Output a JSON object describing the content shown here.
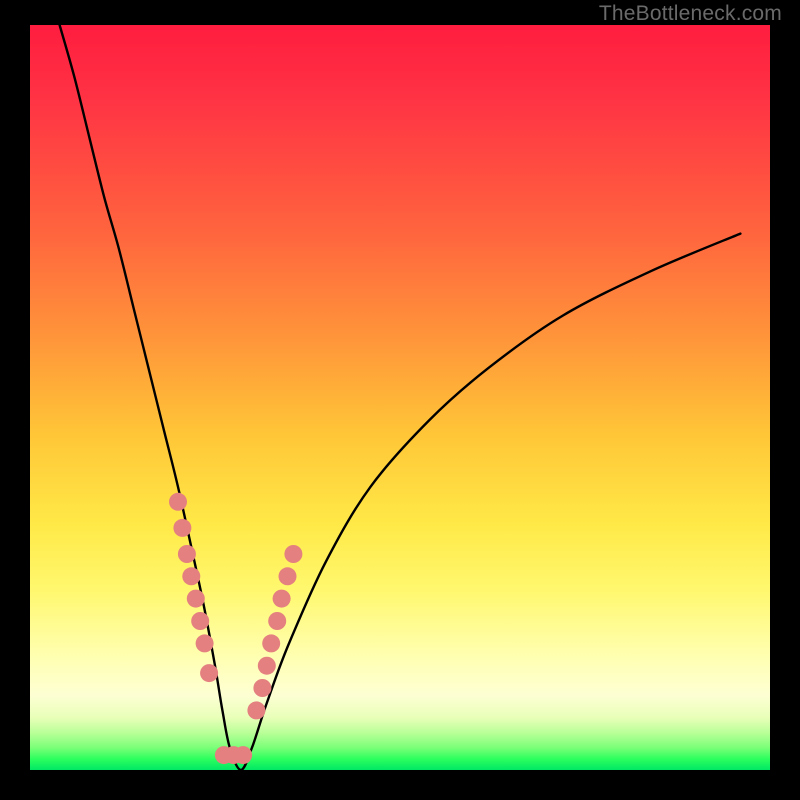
{
  "watermark": "TheBottleneck.com",
  "chart_data": {
    "type": "line",
    "title": "",
    "xlabel": "",
    "ylabel": "",
    "xlim": [
      0,
      100
    ],
    "ylim": [
      0,
      100
    ],
    "series": [
      {
        "name": "bottleneck-curve",
        "x": [
          4,
          6,
          8,
          10,
          12,
          14,
          16,
          18,
          20,
          22,
          23.5,
          25,
          26,
          27,
          28.5,
          30,
          32,
          35,
          40,
          46,
          54,
          62,
          72,
          84,
          96
        ],
        "y": [
          100,
          93,
          85,
          77,
          70,
          62,
          54,
          46,
          38,
          29,
          22,
          14,
          8,
          3,
          0,
          3,
          9,
          17,
          28,
          38,
          47,
          54,
          61,
          67,
          72
        ]
      },
      {
        "name": "marker-dots",
        "x": [
          20.0,
          20.6,
          21.2,
          21.8,
          22.4,
          23.0,
          23.6,
          24.2,
          26.2,
          27.5,
          28.8,
          30.6,
          31.4,
          32.0,
          32.6,
          33.4,
          34.0,
          34.8,
          35.6
        ],
        "y": [
          36,
          32.5,
          29,
          26,
          23,
          20,
          17,
          13,
          2,
          2,
          2,
          8,
          11,
          14,
          17,
          20,
          23,
          26,
          29
        ]
      }
    ],
    "colors": {
      "curve": "#000000",
      "dots": "#e48080",
      "gradient_top": "#ff1d3f",
      "gradient_bottom": "#00e765"
    }
  }
}
